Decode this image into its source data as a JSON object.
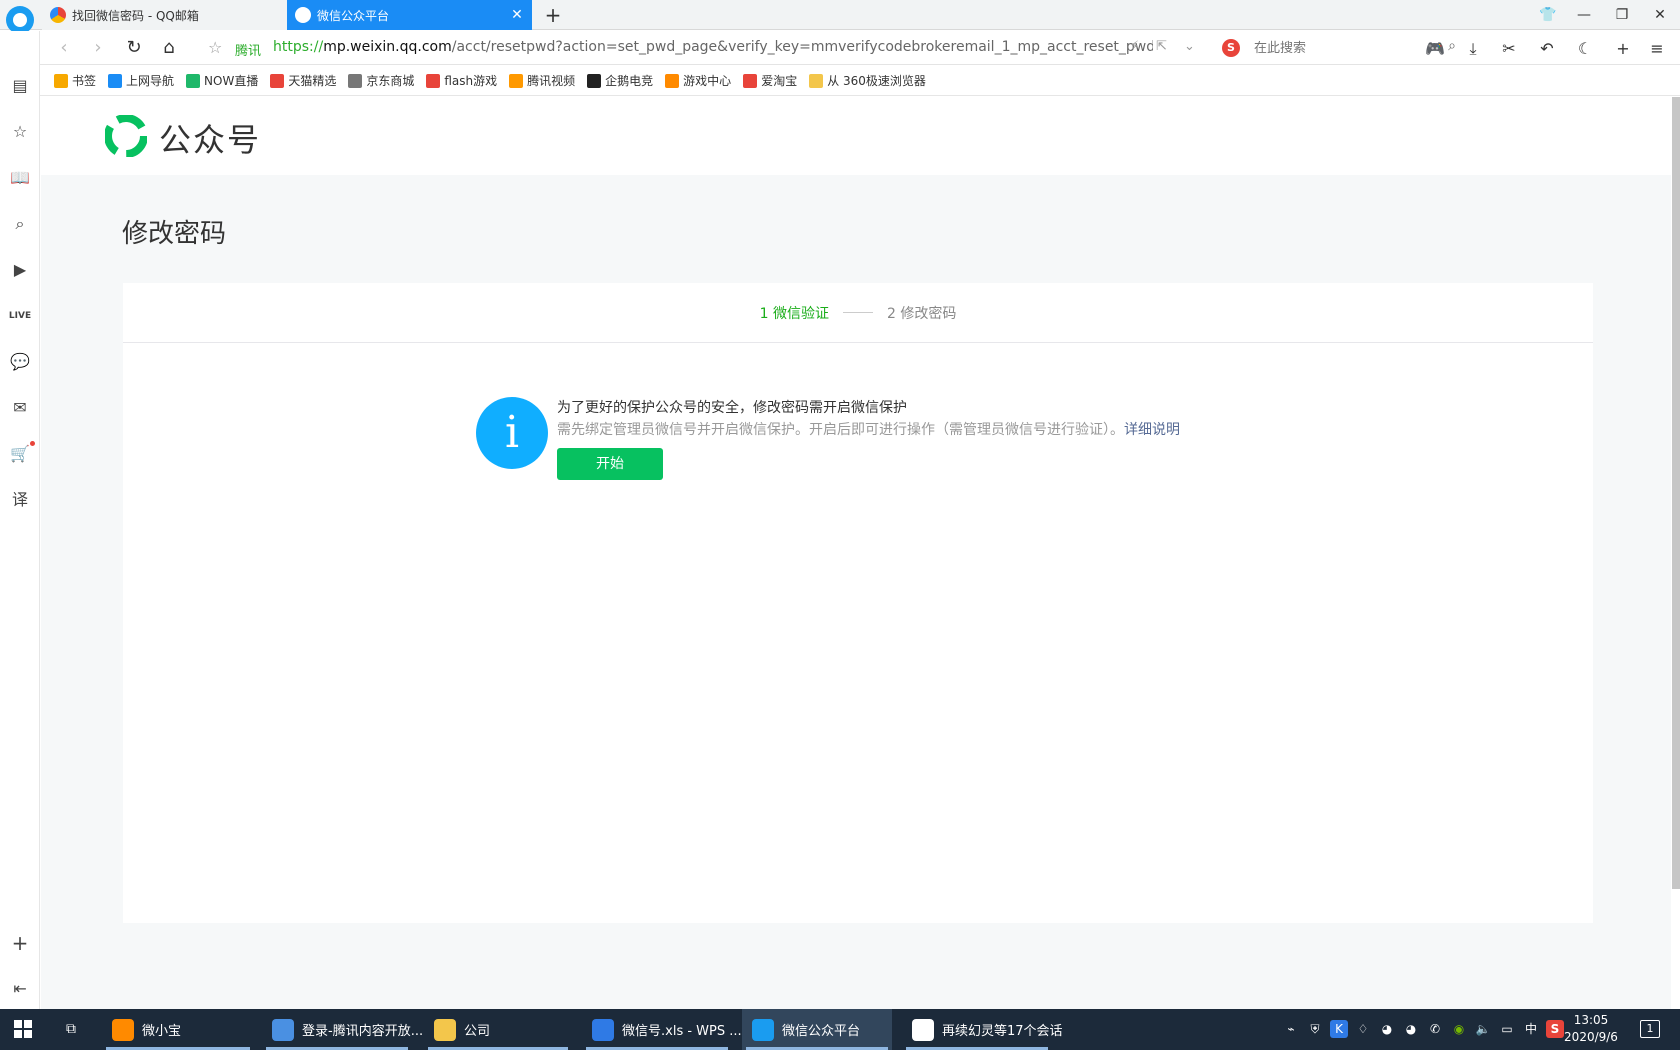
{
  "browser": {
    "tabs": [
      {
        "label": "找回微信密码 - QQ邮箱"
      },
      {
        "label": "微信公众平台"
      }
    ],
    "address": {
      "site_brand": "腾讯",
      "url_scheme": "https://",
      "url_host": "mp.weixin.qq.com",
      "url_path": "/acct/resetpwd?action=set_pwd_page&verify_key=mmverifycodebrokeremail_1_mp_acct_reset_pwd_"
    },
    "search": {
      "placeholder": "在此搜索",
      "engine_glyph": "S"
    },
    "bookmarks": [
      {
        "label": "书签",
        "color": "#f7a800"
      },
      {
        "label": "上网导航",
        "color": "#1a8cf5"
      },
      {
        "label": "NOW直播",
        "color": "#1fb86a"
      },
      {
        "label": "天猫精选",
        "color": "#e8443a"
      },
      {
        "label": "京东商城",
        "color": "#777777"
      },
      {
        "label": "flash游戏",
        "color": "#e8443a"
      },
      {
        "label": "腾讯视频",
        "color": "#ff9900"
      },
      {
        "label": "企鹅电竞",
        "color": "#222222"
      },
      {
        "label": "游戏中心",
        "color": "#ff8a00"
      },
      {
        "label": "爱淘宝",
        "color": "#e8443a"
      },
      {
        "label": "从 360极速浏览器",
        "color": "#f3c64b"
      }
    ]
  },
  "page": {
    "brand_name": "公众号",
    "title": "修改密码",
    "steps": {
      "step1": "1 微信验证",
      "step2": "2 修改密码"
    },
    "message": {
      "title": "为了更好的保护公众号的安全，修改密码需开启微信保护",
      "desc": "需先绑定管理员微信号并开启微信保护。开启后即可进行操作（需管理员微信号进行验证）。",
      "link": "详细说明"
    },
    "start_button": "开始"
  },
  "taskbar": {
    "items": [
      {
        "label": "微小宝",
        "color": "#ff8a00"
      },
      {
        "label": "登录-腾讯内容开放...",
        "color": "#4a90e2"
      },
      {
        "label": "公司",
        "color": "#f3c64b"
      },
      {
        "label": "微信号.xls - WPS ...",
        "color": "#2f7ae5"
      },
      {
        "label": "微信公众平台",
        "color": "#1a9cf0"
      },
      {
        "label": "再续幻灵等17个会话",
        "color": "#ffffff"
      }
    ],
    "time": "13:05",
    "date": "2020/9/6",
    "ime": "中",
    "notification_count": "1"
  },
  "colors": {
    "accent_green": "#07c160",
    "step_active": "#1aad19",
    "info_blue": "#10aeff",
    "link": "#576b95"
  }
}
